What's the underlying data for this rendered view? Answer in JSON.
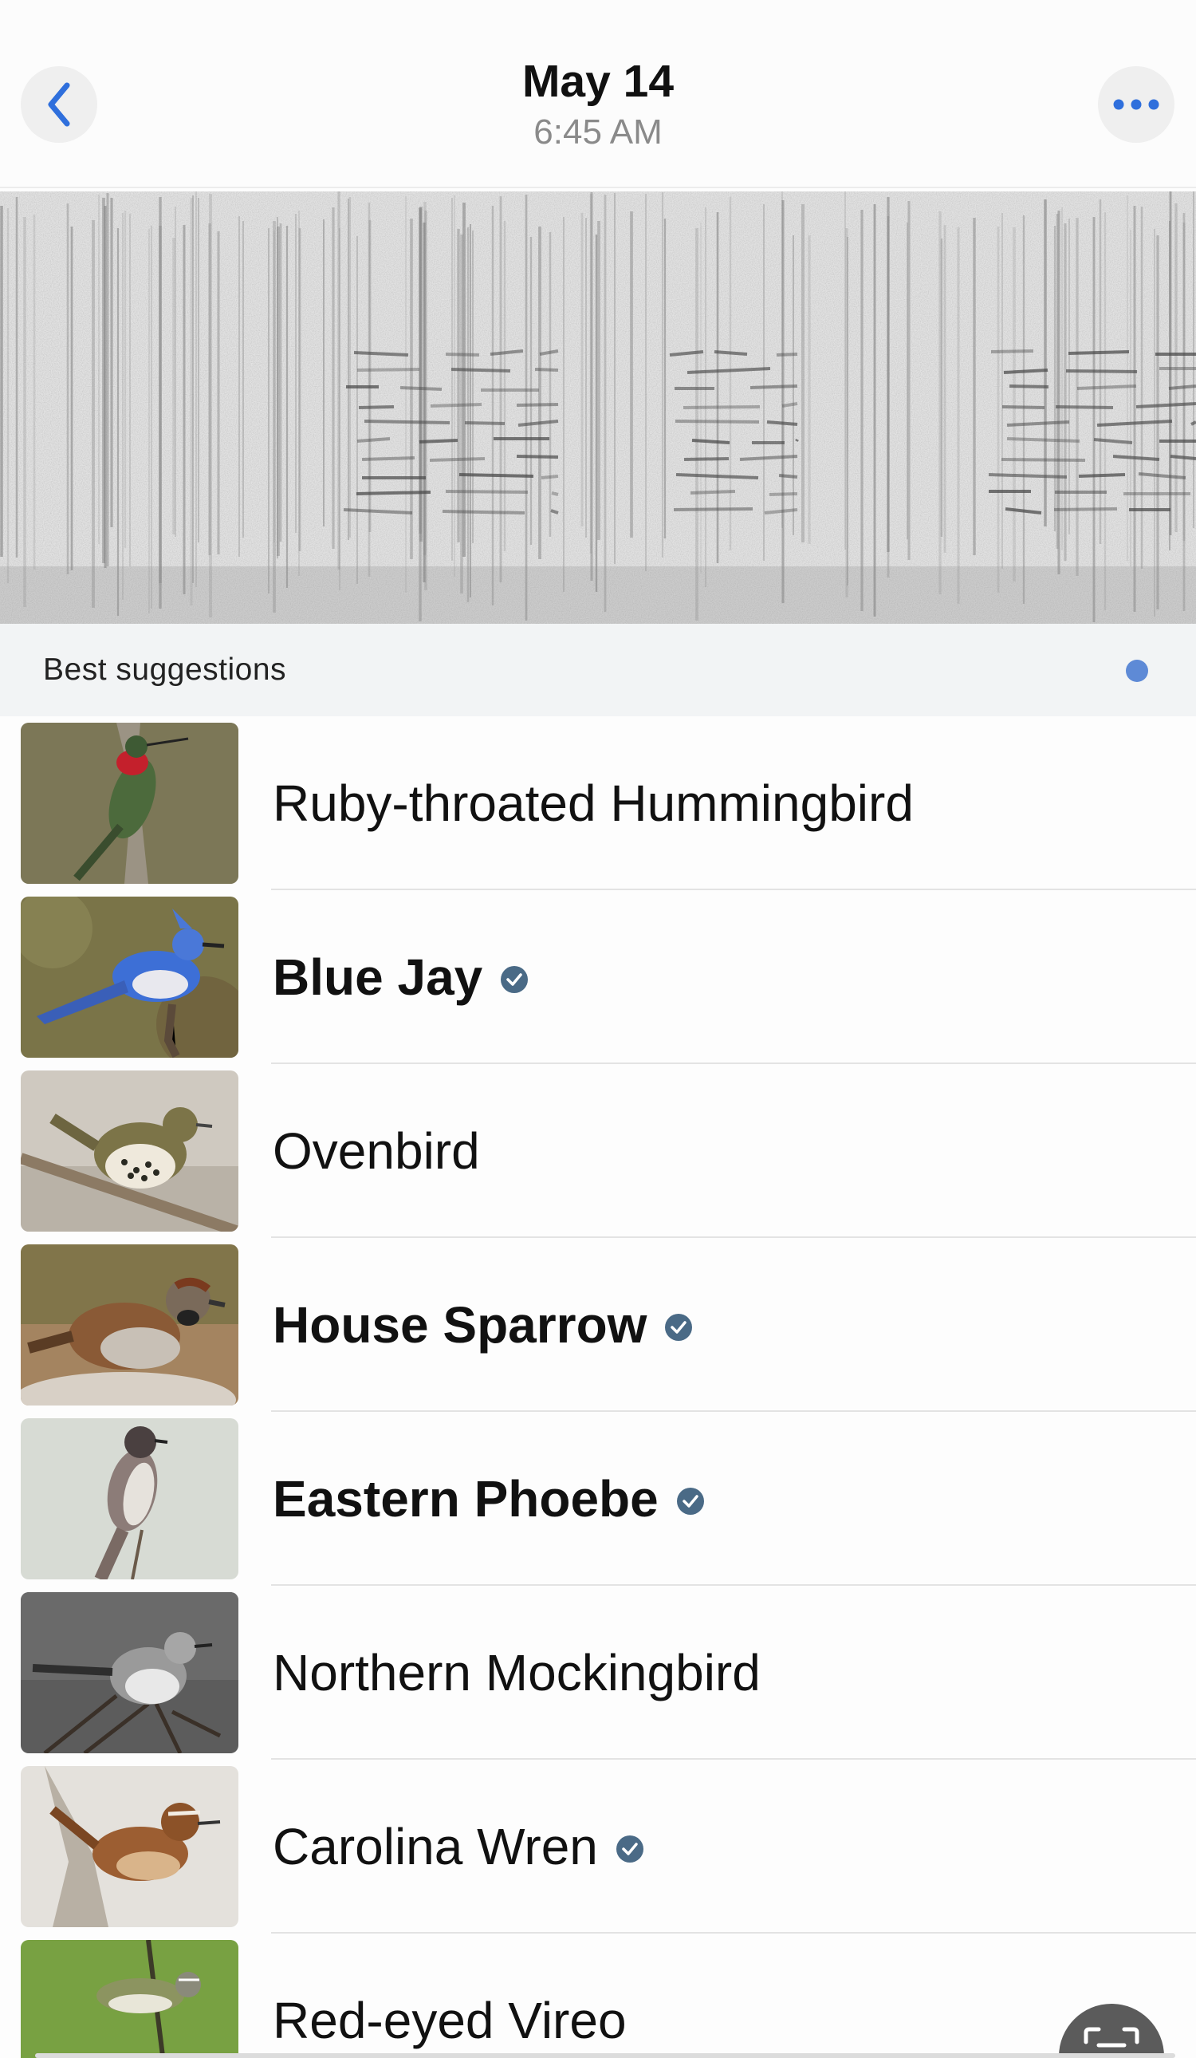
{
  "header": {
    "date": "May 14",
    "time": "6:45 AM",
    "back_icon": "chevron-left-icon",
    "more_icon": "ellipsis-icon",
    "accent_color": "#2f6fdc"
  },
  "spectrogram": {
    "icon": "audio-spectrogram"
  },
  "suggestions": {
    "section_label": "Best suggestions",
    "indicator_color": "#5e8ad6",
    "items": [
      {
        "name": "Ruby-throated Hummingbird",
        "verified": false,
        "bold": false
      },
      {
        "name": "Blue Jay",
        "verified": true,
        "bold": true
      },
      {
        "name": "Ovenbird",
        "verified": false,
        "bold": false
      },
      {
        "name": "House Sparrow",
        "verified": true,
        "bold": true
      },
      {
        "name": "Eastern Phoebe",
        "verified": true,
        "bold": true
      },
      {
        "name": "Northern Mockingbird",
        "verified": false,
        "bold": false
      },
      {
        "name": "Carolina Wren",
        "verified": true,
        "bold": false
      },
      {
        "name": "Red-eyed Vireo",
        "verified": false,
        "bold": false
      }
    ]
  },
  "fab": {
    "icon": "scan-icon"
  }
}
